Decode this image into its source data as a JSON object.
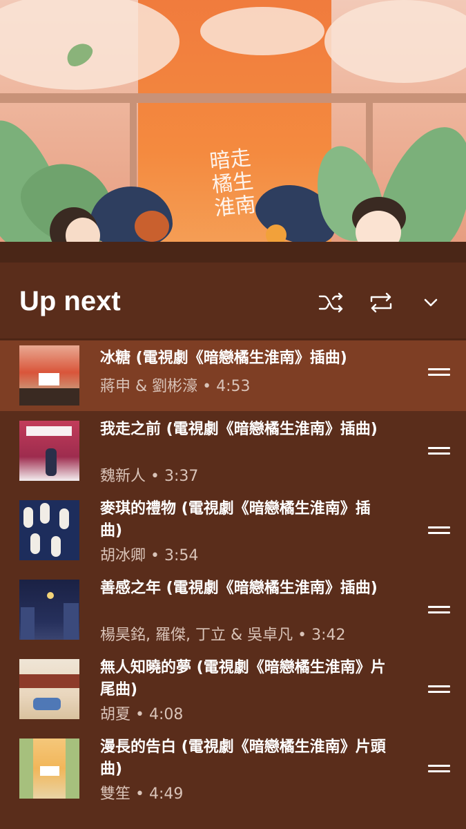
{
  "header": {
    "title": "Up next",
    "shuffle_icon": "shuffle-icon",
    "repeat_icon": "repeat-icon",
    "collapse_icon": "chevron-down-icon"
  },
  "album_art": {
    "calligraphy": "暗走橘生淮南"
  },
  "colors": {
    "panel_bg": "#5a2d1b",
    "active_row_bg": "#7e3e24",
    "secondary_text": "#d9c3b8"
  },
  "queue": [
    {
      "title": "冰糖 (電視劇《暗戀橘生淮南》插曲)",
      "subtitle": "蔣申 & 劉彬濠 • 4:53",
      "active": true
    },
    {
      "title": "我走之前 (電視劇《暗戀橘生淮南》插曲)",
      "subtitle": "魏新人 • 3:37",
      "active": false
    },
    {
      "title": "麥琪的禮物 (電視劇《暗戀橘生淮南》插曲)",
      "subtitle": "胡冰卿 • 3:54",
      "active": false
    },
    {
      "title": "善感之年 (電視劇《暗戀橘生淮南》插曲)",
      "subtitle": "楊昊銘, 羅傑, 丁立 & 吳卓凡 • 3:42",
      "active": false
    },
    {
      "title": "無人知曉的夢 (電視劇《暗戀橘生淮南》片尾曲)",
      "subtitle": "胡夏 • 4:08",
      "active": false
    },
    {
      "title": "漫長的告白 (電視劇《暗戀橘生淮南》片頭曲)",
      "subtitle": "雙笙 • 4:49",
      "active": false
    }
  ]
}
